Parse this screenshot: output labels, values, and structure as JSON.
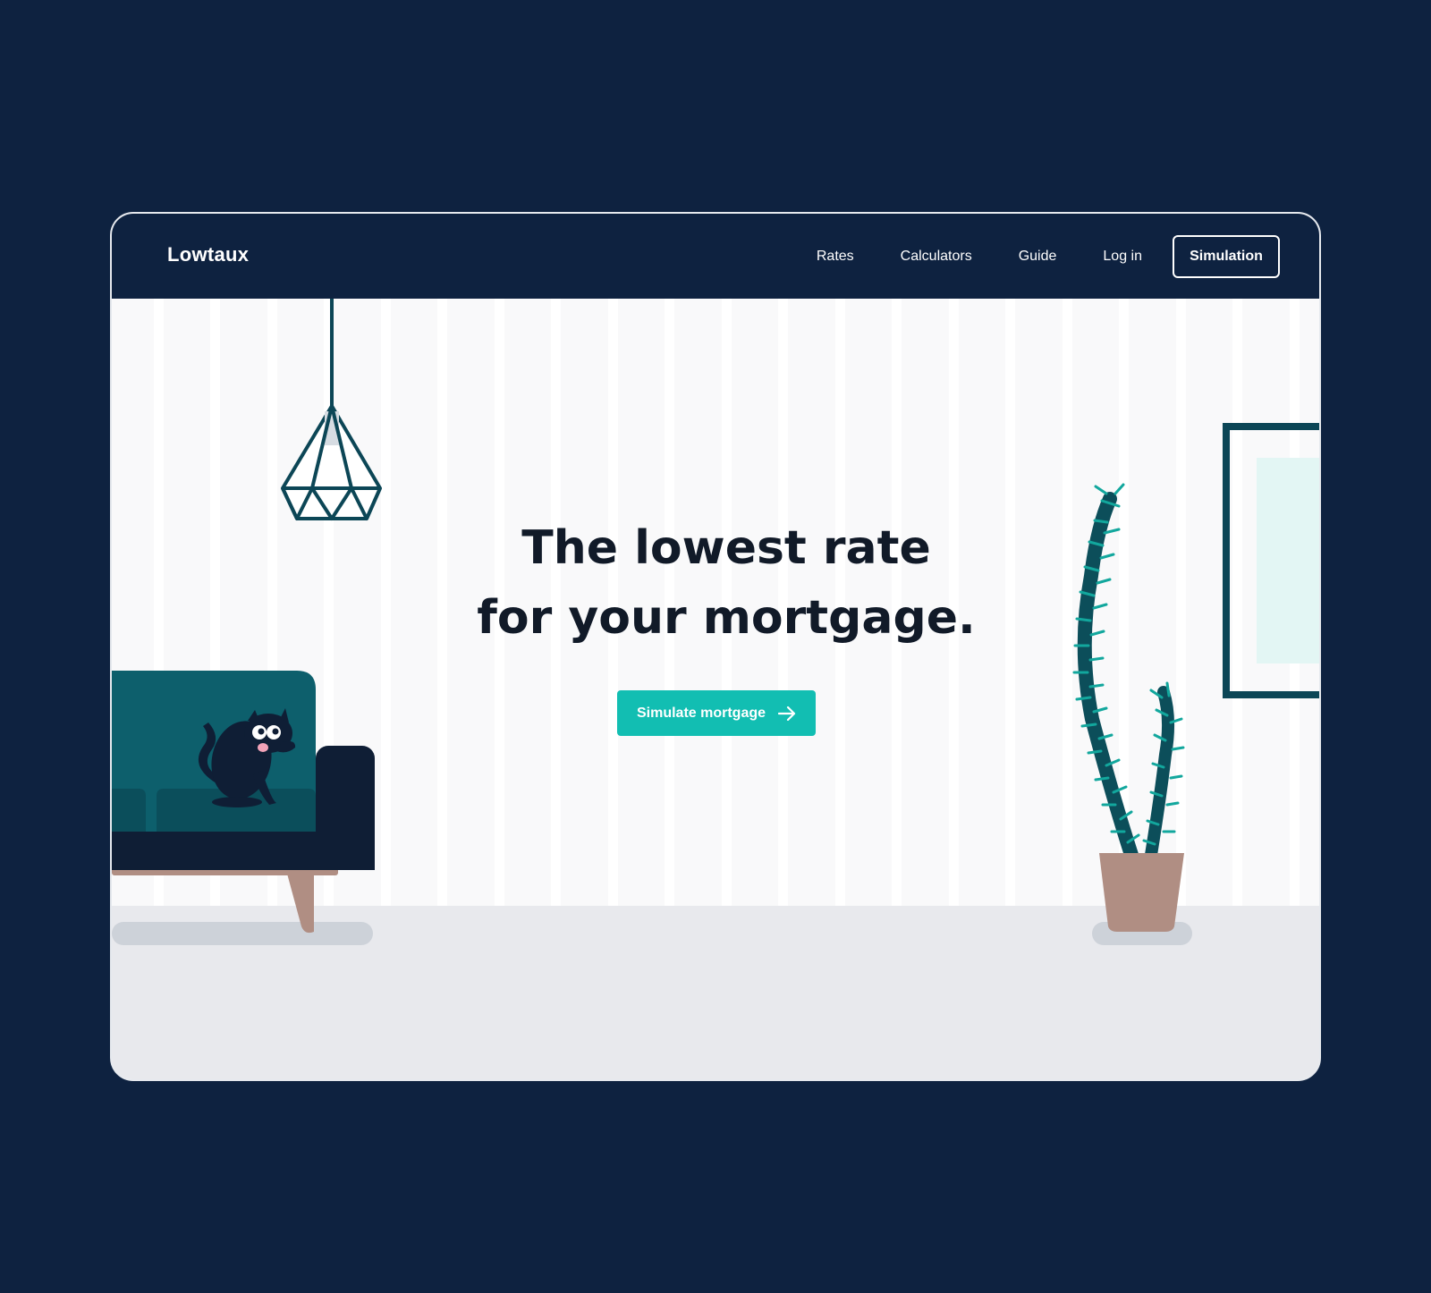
{
  "brand": {
    "name": "Lowtaux"
  },
  "nav": {
    "links": [
      "Rates",
      "Calculators",
      "Guide",
      "Log in"
    ],
    "cta_label": "Simulation"
  },
  "hero": {
    "title_line1": "The lowest rate",
    "title_line2": "for your mortgage.",
    "cta_label": "Simulate mortgage",
    "cta_icon": "arrow-right-icon"
  },
  "colors": {
    "navy": "#0e2240",
    "teal_accent": "#12beb2",
    "sofa_teal": "#0d5f6c",
    "pot": "#b08e83",
    "floor": "#e8e9ed",
    "wall": "#f9f9fa"
  }
}
